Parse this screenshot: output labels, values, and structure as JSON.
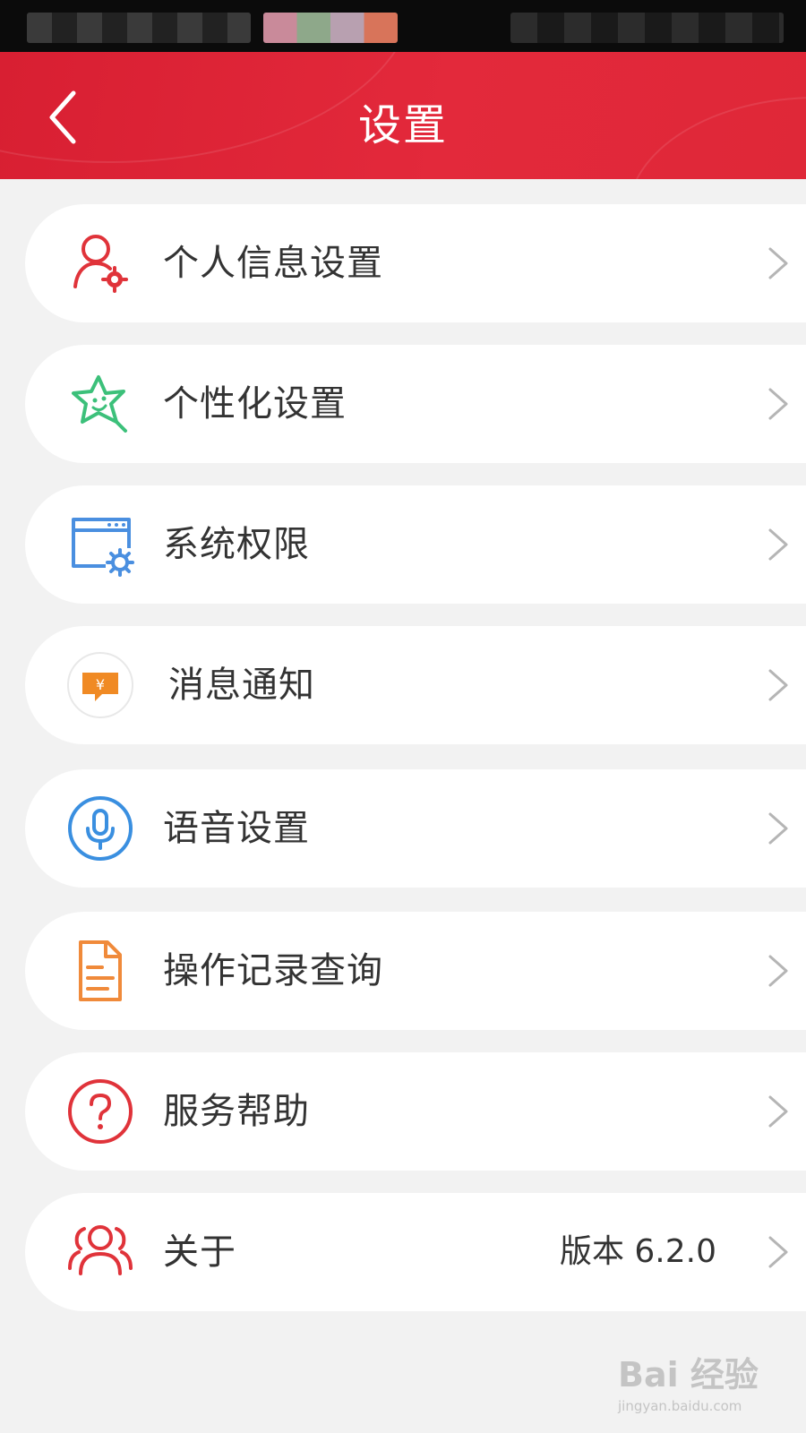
{
  "header": {
    "title": "设置",
    "back_icon": "chevron-left-icon",
    "background_color": "#e0263a"
  },
  "menu": {
    "items": [
      {
        "label": "个人信息设置",
        "icon": "user-settings-icon",
        "icon_color": "#e0333a"
      },
      {
        "label": "个性化设置",
        "icon": "star-personalize-icon",
        "icon_color": "#3cc07a"
      },
      {
        "label": "系统权限",
        "icon": "window-settings-icon",
        "icon_color": "#4a8fe0"
      },
      {
        "label": "消息通知",
        "icon": "message-notification-icon",
        "icon_color": "#f08a24"
      },
      {
        "label": "语音设置",
        "icon": "microphone-icon",
        "icon_color": "#3a8fe0"
      },
      {
        "label": "操作记录查询",
        "icon": "document-icon",
        "icon_color": "#f08a3a"
      },
      {
        "label": "服务帮助",
        "icon": "help-icon",
        "icon_color": "#e0333a"
      },
      {
        "label": "关于",
        "icon": "users-icon",
        "icon_color": "#e0333a",
        "value": "版本 6.2.0"
      }
    ],
    "chevron_icon": "chevron-right-icon"
  },
  "watermark": {
    "logo_text": "Bai 经验",
    "url": "jingyan.baidu.com"
  }
}
